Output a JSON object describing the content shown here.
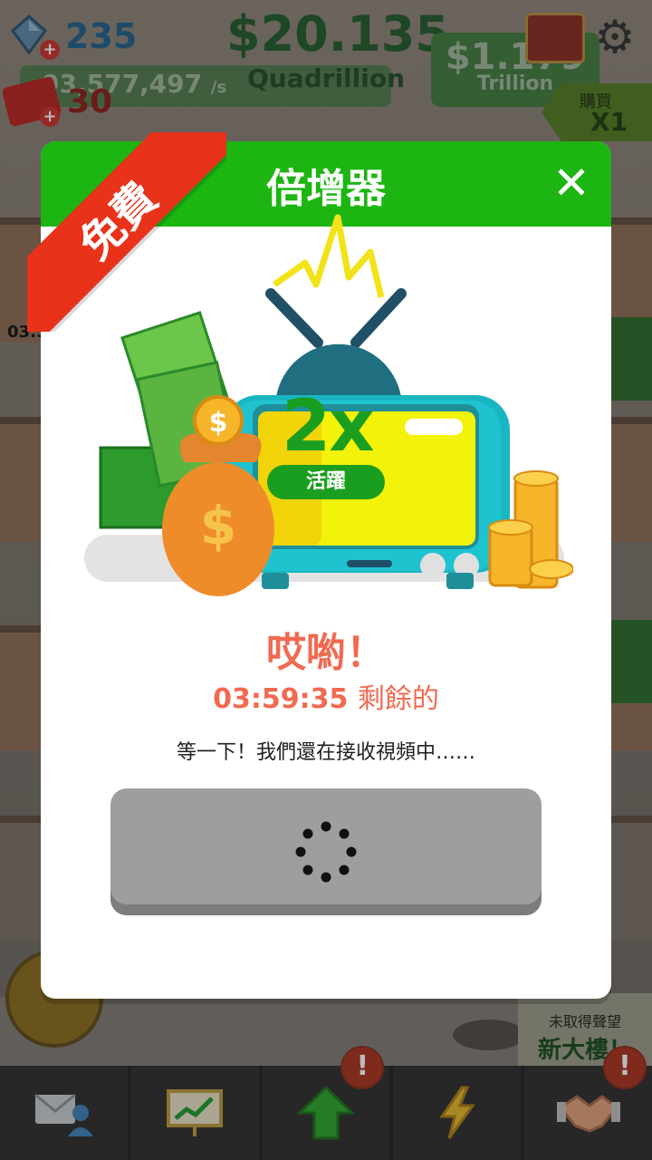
{
  "hud": {
    "gems": "235",
    "rate": "93,577,497",
    "rate_unit": "/s",
    "tickets": "30",
    "money": "$20.135",
    "money_unit": "Quadrillion",
    "upgrade_price": "$1.179",
    "upgrade_unit": "Trillion",
    "buy_label": "購買",
    "buy_multiplier": "X1"
  },
  "side": {
    "timer": "03:5"
  },
  "modal": {
    "title": "倍增器",
    "ribbon": "免費",
    "close": "✕",
    "tv_multiplier": "2x",
    "tv_status": "活躍",
    "oops": "哎喲！",
    "timer": "03:59:35",
    "timer_suffix": "剩餘的",
    "waiting_text": "等一下！我們還在接收視頻中……"
  },
  "reputation": {
    "label": "未取得聲望",
    "title": "新大樓！"
  },
  "bottom_nav": {
    "badge_upgrade": "!",
    "badge_deals": "!"
  },
  "colors": {
    "header_green": "#1db512",
    "ribbon_red": "#e8321a",
    "alert_coral": "#f06a50",
    "tv_teal": "#19b6c2",
    "tv_screen_yellow": "#f2f20a"
  }
}
